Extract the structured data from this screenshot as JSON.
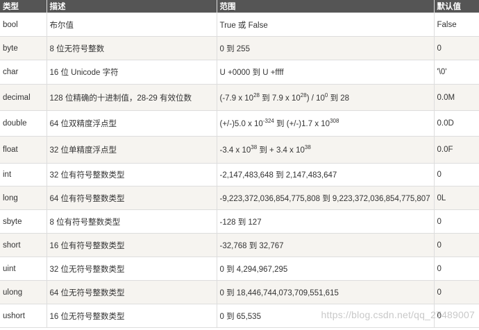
{
  "headers": {
    "type": "类型",
    "desc": "描述",
    "range": "范围",
    "default": "默认值"
  },
  "rows": [
    {
      "type": "bool",
      "desc": "布尔值",
      "range": "True 或 False",
      "default": "False"
    },
    {
      "type": "byte",
      "desc": "8 位无符号整数",
      "range": "0 到 255",
      "default": "0"
    },
    {
      "type": "char",
      "desc": "16 位 Unicode 字符",
      "range": "U +0000 到 U +ffff",
      "default": "'\\0'"
    },
    {
      "type": "decimal",
      "desc": "128 位精确的十进制值，28-29 有效位数",
      "range": {
        "a": "(-7.9 x 10",
        "e1": "28",
        "b": " 到 7.9 x 10",
        "e2": "28",
        "c": ") / 10",
        "e3": "0",
        "d": " 到 28"
      },
      "default": "0.0M"
    },
    {
      "type": "double",
      "desc": "64 位双精度浮点型",
      "range": {
        "a": "(+/-)5.0 x 10",
        "e1": "-324",
        "b": " 到 (+/-)1.7 x 10",
        "e2": "308"
      },
      "default": "0.0D"
    },
    {
      "type": "float",
      "desc": "32 位单精度浮点型",
      "range": {
        "a": "-3.4 x 10",
        "e1": "38",
        "b": " 到 + 3.4 x 10",
        "e2": "38"
      },
      "default": "0.0F"
    },
    {
      "type": "int",
      "desc": "32 位有符号整数类型",
      "range": "-2,147,483,648 到 2,147,483,647",
      "default": "0"
    },
    {
      "type": "long",
      "desc": "64 位有符号整数类型",
      "range": "-9,223,372,036,854,775,808 到 9,223,372,036,854,775,807",
      "default": "0L"
    },
    {
      "type": "sbyte",
      "desc": "8 位有符号整数类型",
      "range": "-128 到 127",
      "default": "0"
    },
    {
      "type": "short",
      "desc": "16 位有符号整数类型",
      "range": "-32,768 到 32,767",
      "default": "0"
    },
    {
      "type": "uint",
      "desc": "32 位无符号整数类型",
      "range": "0 到 4,294,967,295",
      "default": "0"
    },
    {
      "type": "ulong",
      "desc": "64 位无符号整数类型",
      "range": "0 到 18,446,744,073,709,551,615",
      "default": "0"
    },
    {
      "type": "ushort",
      "desc": "16 位无符号整数类型",
      "range": "0 到 65,535",
      "default": "0"
    }
  ],
  "watermark": "https://blog.csdn.net/qq_27489007"
}
